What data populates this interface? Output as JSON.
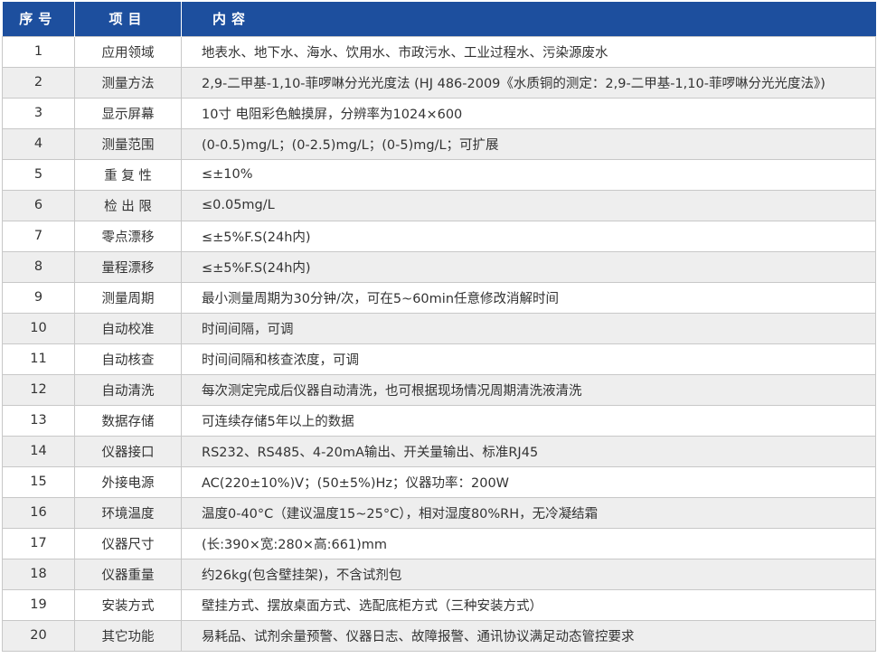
{
  "header": {
    "no": "序号",
    "item": "项目",
    "content": "内容"
  },
  "rows": [
    {
      "no": "1",
      "item": "应用领域",
      "content": "地表水、地下水、海水、饮用水、市政污水、工业过程水、污染源废水"
    },
    {
      "no": "2",
      "item": "测量方法",
      "content": "2,9-二甲基-1,10-菲啰啉分光光度法 (HJ 486-2009《水质铜的测定：2,9-二甲基-1,10-菲啰啉分光光度法》)"
    },
    {
      "no": "3",
      "item": "显示屏幕",
      "content": "10寸 电阻彩色触摸屏，分辨率为1024×600"
    },
    {
      "no": "4",
      "item": "测量范围",
      "content": "(0-0.5)mg/L；(0-2.5)mg/L；(0-5)mg/L；可扩展"
    },
    {
      "no": "5",
      "item": "重 复 性",
      "content": "≤±10%"
    },
    {
      "no": "6",
      "item": "检 出 限",
      "content": "≤0.05mg/L"
    },
    {
      "no": "7",
      "item": "零点漂移",
      "content": "≤±5%F.S(24h内)"
    },
    {
      "no": "8",
      "item": "量程漂移",
      "content": "≤±5%F.S(24h内)"
    },
    {
      "no": "9",
      "item": "测量周期",
      "content": "最小测量周期为30分钟/次，可在5~60min任意修改消解时间"
    },
    {
      "no": "10",
      "item": "自动校准",
      "content": "时间间隔，可调"
    },
    {
      "no": "11",
      "item": "自动核查",
      "content": "时间间隔和核查浓度，可调"
    },
    {
      "no": "12",
      "item": "自动清洗",
      "content": "每次测定完成后仪器自动清洗，也可根据现场情况周期清洗液清洗"
    },
    {
      "no": "13",
      "item": "数据存储",
      "content": "可连续存储5年以上的数据"
    },
    {
      "no": "14",
      "item": "仪器接口",
      "content": "RS232、RS485、4-20mA输出、开关量输出、标准RJ45"
    },
    {
      "no": "15",
      "item": "外接电源",
      "content": "AC(220±10%)V；(50±5%)Hz；仪器功率：200W"
    },
    {
      "no": "16",
      "item": "环境温度",
      "content": "温度0-40°C（建议温度15~25°C），相对湿度80%RH，无冷凝结霜"
    },
    {
      "no": "17",
      "item": "仪器尺寸",
      "content": "(长:390×宽:280×高:661)mm"
    },
    {
      "no": "18",
      "item": "仪器重量",
      "content": "约26kg(包含壁挂架)，不含试剂包"
    },
    {
      "no": "19",
      "item": "安装方式",
      "content": "壁挂方式、摆放桌面方式、选配底柜方式（三种安装方式）"
    },
    {
      "no": "20",
      "item": "其它功能",
      "content": "易耗品、试剂余量预警、仪器日志、故障报警、通讯协议满足动态管控要求"
    }
  ],
  "colors": {
    "header_bg": "#1d4f9e",
    "header_text": "#ffffff",
    "row_alt_bg": "#eeeeee",
    "border": "#c8c8c8"
  }
}
